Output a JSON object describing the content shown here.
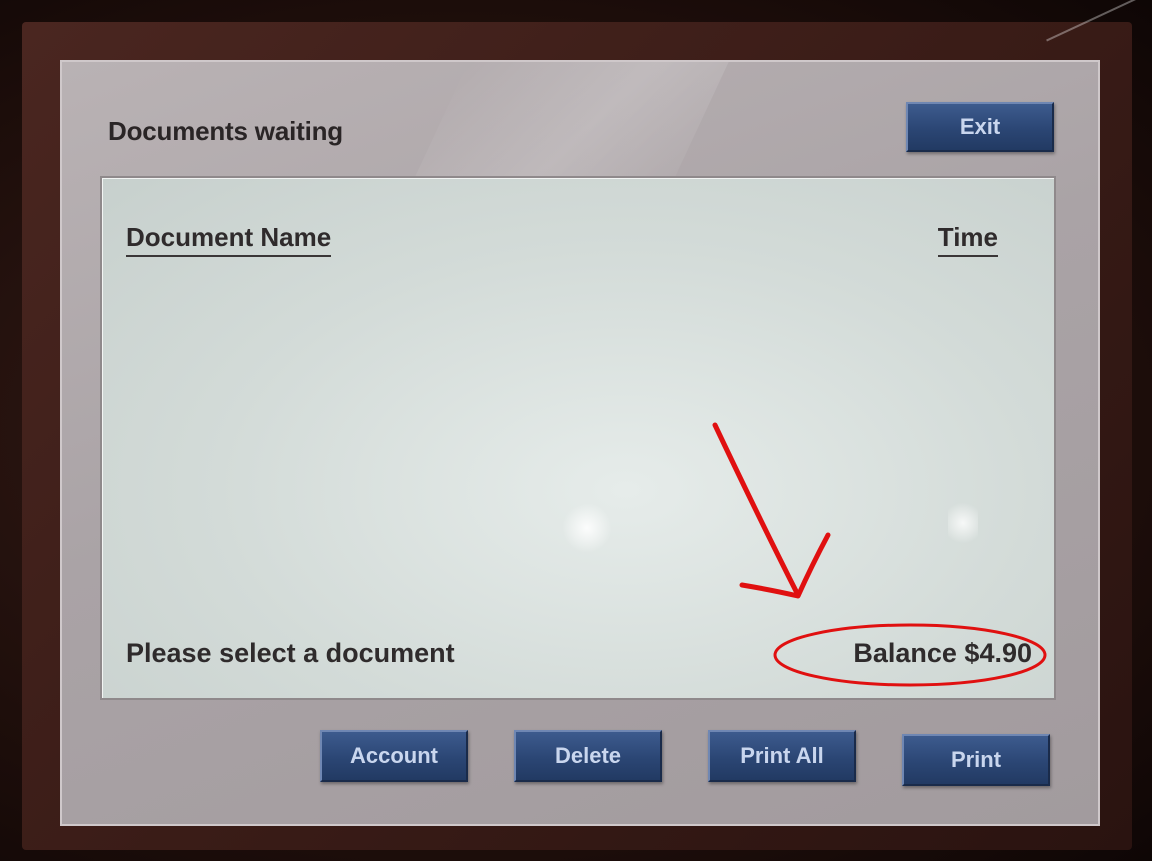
{
  "header": {
    "title": "Documents waiting",
    "exit_label": "Exit"
  },
  "list": {
    "columns": [
      "Document Name",
      "Time"
    ],
    "rows": []
  },
  "status": {
    "message": "Please select a document",
    "balance": "Balance $4.90"
  },
  "actions": {
    "account_label": "Account",
    "delete_label": "Delete",
    "print_all_label": "Print All",
    "print_label": "Print"
  },
  "colors": {
    "button": "#2b4674",
    "annotation": "#e01010"
  },
  "icons": {
    "annotation_arrow": "red-arrow-icon",
    "annotation_circle": "red-ellipse-icon"
  }
}
